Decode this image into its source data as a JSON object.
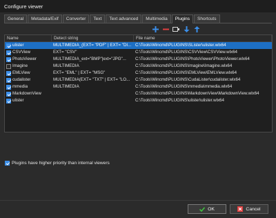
{
  "window": {
    "title": "Configure viewer"
  },
  "tabs": [
    {
      "label": "General"
    },
    {
      "label": "Metadata/Exif"
    },
    {
      "label": "Converter"
    },
    {
      "label": "Text"
    },
    {
      "label": "Text advanced"
    },
    {
      "label": "Multimedia"
    },
    {
      "label": "Plugins",
      "active": true
    },
    {
      "label": "Shortcuts"
    }
  ],
  "toolbar": {
    "icons": [
      "add-icon",
      "remove-icon",
      "edit-icon",
      "move-down-icon",
      "move-up-icon"
    ],
    "colors": {
      "add": "#3b8ee8",
      "remove": "#e04040",
      "arrows": "#3b8ee8"
    }
  },
  "columns": {
    "name": "Name",
    "detect": "Detect string",
    "file": "File name"
  },
  "plugins": [
    {
      "checked": true,
      "name": "ulister",
      "detect": "MULTIMEDIA_(EXT= \"PDF\" | EXT= \"DI...",
      "file": "C:\\Tools\\Wincmd\\PLUGINS\\SLister\\ulister.wlx64",
      "selected": true
    },
    {
      "checked": true,
      "name": "CSVView",
      "detect": "EXT= \"CSV\"",
      "file": "C:\\Tools\\Wincmd\\PLUGINS\\CSVView\\CSVView.wlx64"
    },
    {
      "checked": true,
      "name": "PhotoViewer",
      "detect": "MULTIMEDIA_ext=\"BMP\"|ext=\"JPG\"...",
      "file": "C:\\Tools\\Wincmd\\PLUGINS\\PhotoViewer\\PhotoViewer.wlx64"
    },
    {
      "checked": false,
      "name": "Imagine",
      "detect": "MULTIMEDIA",
      "file": "C:\\Tools\\Wincmd\\PLUGINS\\Imagine\\Imagine.wlx64"
    },
    {
      "checked": true,
      "name": "EMLView",
      "detect": "EXT= \"EML\" | EXT= \"MSG\"",
      "file": "C:\\Tools\\Wincmd\\PLUGINS\\EMLView\\EMLView.wlx64"
    },
    {
      "checked": true,
      "name": "cudalister",
      "detect": "MULTIMEDIA(EXT= \"TXT\" | EXT= \"LO...",
      "file": "C:\\Tools\\Wincmd\\PLUGINS\\CudaLister\\cudalister.wlx64"
    },
    {
      "checked": true,
      "name": "mmedia",
      "detect": "MULTIMEDIA",
      "file": "C:\\Tools\\Wincmd\\PLUGINS\\mmedia\\mmedia.wlx64"
    },
    {
      "checked": true,
      "name": "MarkdownView",
      "detect": "",
      "file": "C:\\Tools\\Wincmd\\PLUGINS\\MarkdownView\\MarkdownView.wlx64"
    },
    {
      "checked": true,
      "name": "ulister",
      "detect": "",
      "file": "C:\\Tools\\Wincmd\\PLUGINS\\ulister\\ulister.wlx64"
    }
  ],
  "priority": {
    "checked": true,
    "label": "Plugins have higher priority than internal viewers"
  },
  "buttons": {
    "ok": "OK",
    "cancel": "Cancel"
  },
  "colors": {
    "selection": "#1d6fc4",
    "ok_icon": "#3fbf3f",
    "cancel_icon": "#e04040"
  }
}
